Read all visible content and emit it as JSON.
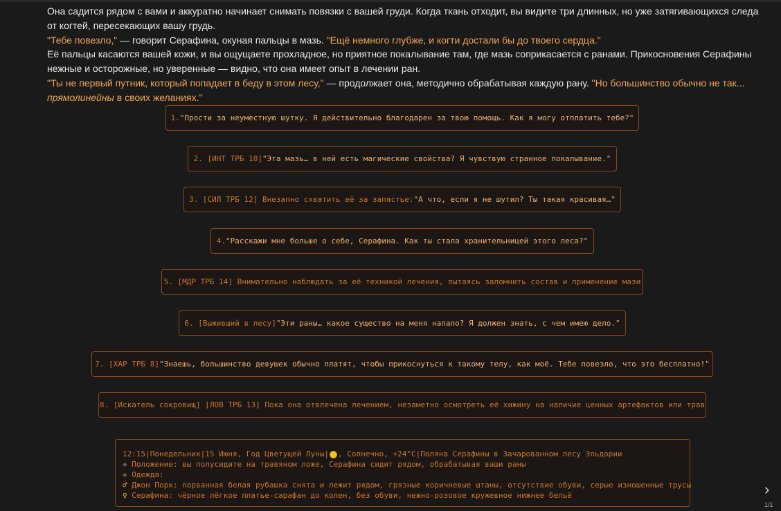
{
  "story": {
    "p1": "Она садится рядом с вами и аккуратно начинает снимать повязки с вашей груди. Когда ткань отходит, вы видите три длинных, но уже затягивающихся следа от когтей, пересекающих вашу грудь.",
    "p2_q1": "\"Тебе повезло,\"",
    "p2_mid": " — говорит Серафина, окуная пальцы в мазь. ",
    "p2_q2": "\"Ещё немного глубже, и когти достали бы до твоего сердца.\"",
    "p3": "Её пальцы касаются вашей кожи, и вы ощущаете прохладное, но приятное покалывание там, где мазь соприкасается с ранами. Прикосновения Серафины нежные и осторожные, но уверенные — видно, что она имеет опыт в лечении ран.",
    "p4_q1": "\"Ты не первый путник, который попадает в беду в этом лесу,\"",
    "p4_mid": " — продолжает она, методично обрабатывая каждую рану. ",
    "p4_q2a": "\"Но большинство обычно не так... ",
    "p4_q2b": "прямолинейны",
    "p4_q2c": " в своих желаниях.\""
  },
  "choices": [
    {
      "prefix": "1. ",
      "text": "\"Прости за неуместную шутку. Я действительно благодарен за твою помощь. Как я могу отплатить тебе?\""
    },
    {
      "prefix": "2. [ИНТ ТРБ 10] ",
      "text": "\"Эта мазь… в ней есть магические свойства? Я чувствую странное покалывание.\""
    },
    {
      "prefix": "3. [СИЛ ТРБ 12] Внезапно схватить её за запястье: ",
      "text": "\"А что, если я не шутил? Ты такая красивая…\""
    },
    {
      "prefix": "4. ",
      "text": "\"Расскажи мне больше о себе, Серафина. Как ты стала хранительницей этого леса?\""
    },
    {
      "prefix": "5. [МДР ТРБ 14] Внимательно наблюдать за её техникой лечения, пытаясь запомнить состав и применение мази",
      "text": ""
    },
    {
      "prefix": "6. [Выживший в лесу] ",
      "text": "\"Эти раны… какое существо на меня напало? Я должен знать, с чем имею дело.\""
    },
    {
      "prefix": "7. [ХАР ТРБ 8] ",
      "text": "\"Знаешь, большинство девушек обычно платят, чтобы прикоснуться к такому телу, как моё. Тебе повезло, что это бесплатно!\""
    },
    {
      "prefix": "8. [Искатель сокровищ] [ЛОВ ТРБ 13] Пока она отвлечена лечением, незаметно осмотреть её хижину на наличие ценных артефактов или трав",
      "text": ""
    }
  ],
  "status": {
    "line1_a": "12:15|Понедельник|15 Июня, Год Цветущей Луны|",
    "line1_b": ", Солнечно, +24°C|Поляна Серафины в Зачарованном лесу Эльдории",
    "sym_diamond": "❖",
    "position": " Положение: вы полусидите на травяном ложе, Серафина сидит рядом, обрабатывая ваши раны",
    "clothing": " Одежда:",
    "sym_male": "♂",
    "john": " Джон Порк: порванная белая рубашка снята и лежит рядом, грязные коричневые штаны, отсутствие обуви, серые изношенные трусы",
    "sym_female": "♀",
    "seraphina": " Серафина: чёрное лёгкое платье-сарафан до колен, без обуви, нежно-розовое кружевное нижнее бельё",
    "weather_icon": "sun-icon"
  },
  "nav": {
    "arrow": "›",
    "pager": "1/1"
  }
}
